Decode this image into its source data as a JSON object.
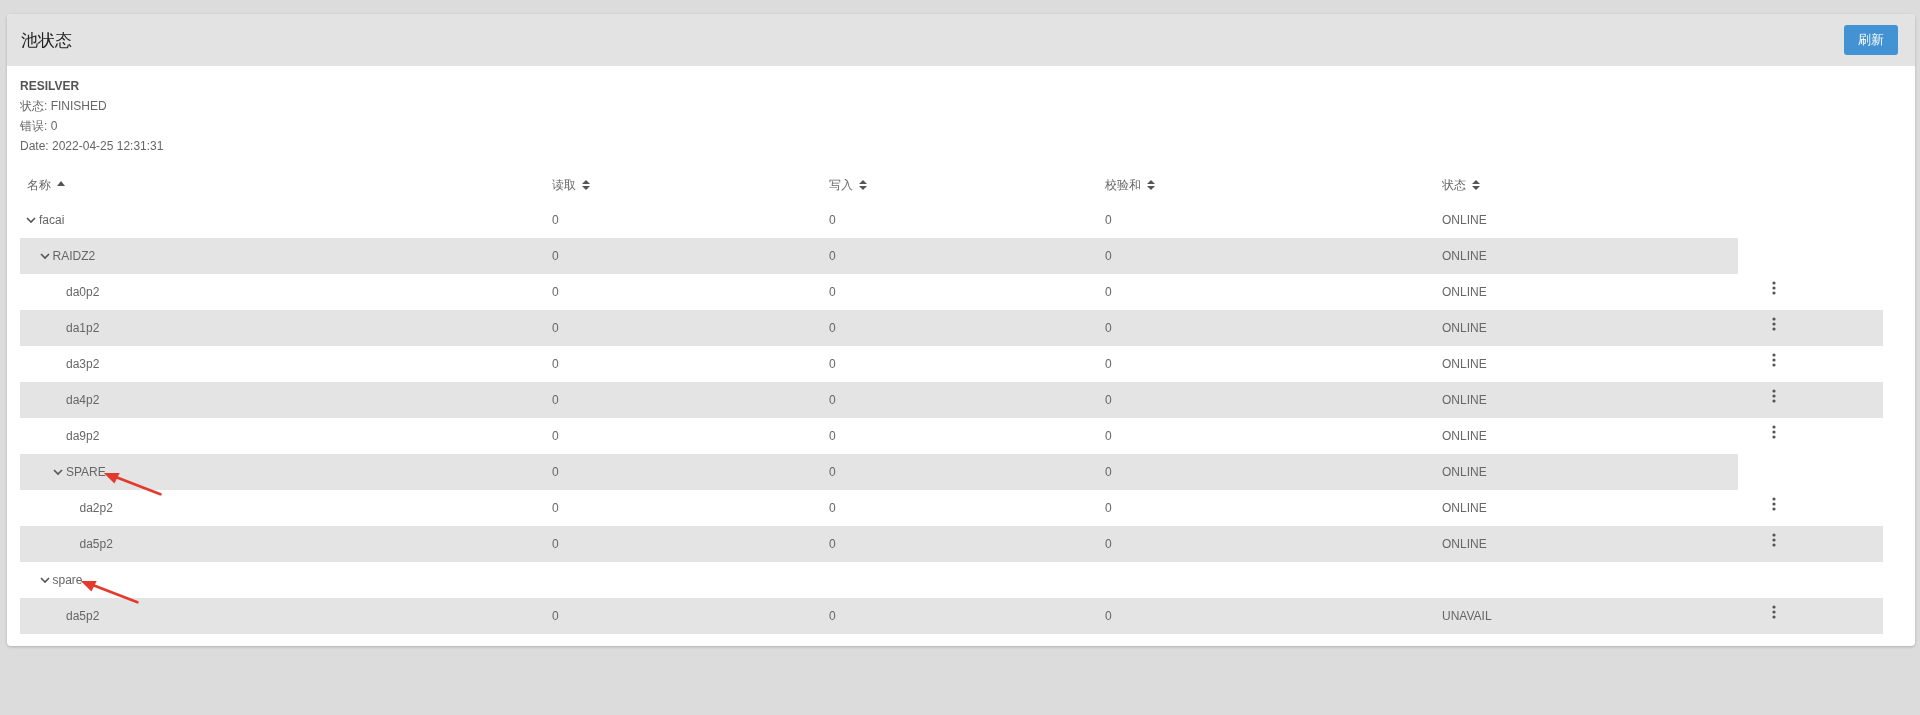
{
  "panel": {
    "title": "池状态",
    "refresh_button": "刷新"
  },
  "scan": {
    "title": "RESILVER",
    "lines": [
      "状态: FINISHED",
      "错误: 0",
      "Date: 2022-04-25 12:31:31"
    ]
  },
  "table": {
    "columns": [
      {
        "label": "名称",
        "sorted": true
      },
      {
        "label": "读取",
        "sorted": false
      },
      {
        "label": "写入",
        "sorted": false
      },
      {
        "label": "校验和",
        "sorted": false
      },
      {
        "label": "状态",
        "sorted": false
      }
    ],
    "rows": [
      {
        "kind": "group",
        "name": "facai",
        "expanded": true,
        "read": "0",
        "write": "0",
        "checksum": "0",
        "status": "ONLINE",
        "children": [
          {
            "kind": "group",
            "name": "RAIDZ2",
            "expanded": true,
            "read": "0",
            "write": "0",
            "checksum": "0",
            "status": "ONLINE",
            "children": [
              {
                "kind": "disk",
                "name": "da0p2",
                "read": "0",
                "write": "0",
                "checksum": "0",
                "status": "ONLINE"
              },
              {
                "kind": "disk",
                "name": "da1p2",
                "read": "0",
                "write": "0",
                "checksum": "0",
                "status": "ONLINE"
              },
              {
                "kind": "disk",
                "name": "da3p2",
                "read": "0",
                "write": "0",
                "checksum": "0",
                "status": "ONLINE"
              },
              {
                "kind": "disk",
                "name": "da4p2",
                "read": "0",
                "write": "0",
                "checksum": "0",
                "status": "ONLINE"
              },
              {
                "kind": "disk",
                "name": "da9p2",
                "read": "0",
                "write": "0",
                "checksum": "0",
                "status": "ONLINE"
              },
              {
                "kind": "group",
                "name": "SPARE",
                "expanded": true,
                "annotated": true,
                "read": "0",
                "write": "0",
                "checksum": "0",
                "status": "ONLINE",
                "children": [
                  {
                    "kind": "disk",
                    "name": "da2p2",
                    "read": "0",
                    "write": "0",
                    "checksum": "0",
                    "status": "ONLINE"
                  },
                  {
                    "kind": "disk",
                    "name": "da5p2",
                    "read": "0",
                    "write": "0",
                    "checksum": "0",
                    "status": "ONLINE"
                  }
                ]
              }
            ]
          },
          {
            "kind": "group",
            "name": "spare",
            "expanded": true,
            "annotated": true,
            "children": [
              {
                "kind": "disk",
                "name": "da5p2",
                "read": "0",
                "write": "0",
                "checksum": "0",
                "status": "UNAVAIL"
              }
            ]
          }
        ]
      }
    ]
  }
}
